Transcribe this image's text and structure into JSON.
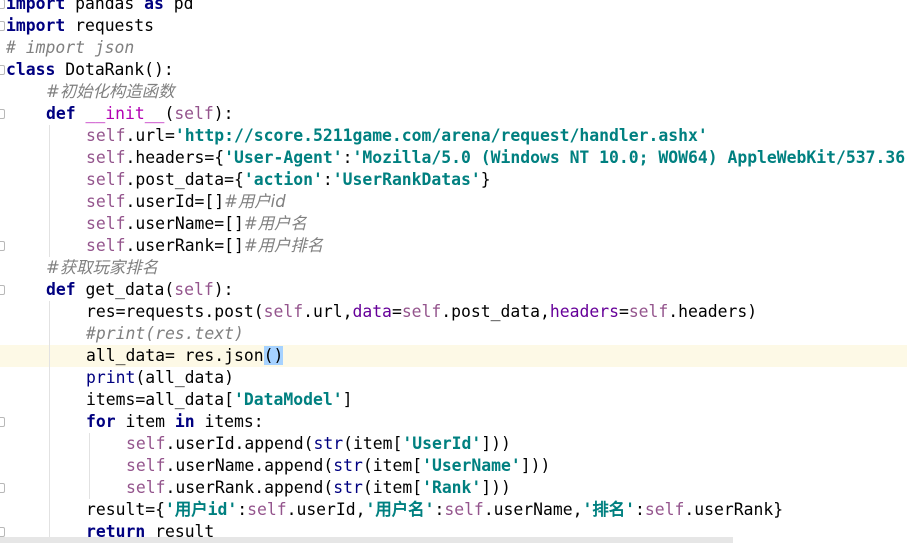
{
  "editor": {
    "language": "python",
    "current_line": 16,
    "lines": [
      {
        "indent": 0,
        "fold": true,
        "tokens": [
          [
            "kw",
            "import"
          ],
          [
            "plain",
            " pandas "
          ],
          [
            "kw",
            "as"
          ],
          [
            "plain",
            " pd"
          ]
        ]
      },
      {
        "indent": 0,
        "fold": true,
        "tokens": [
          [
            "kw",
            "import"
          ],
          [
            "plain",
            " requests"
          ]
        ]
      },
      {
        "indent": 0,
        "fold": false,
        "tokens": [
          [
            "cmt",
            "# import json"
          ]
        ]
      },
      {
        "indent": 0,
        "fold": true,
        "tokens": [
          [
            "kw",
            "class"
          ],
          [
            "plain",
            " DotaRank():"
          ]
        ]
      },
      {
        "indent": 1,
        "fold": false,
        "tokens": [
          [
            "cmt-cn",
            "#初始化构造函数"
          ]
        ]
      },
      {
        "indent": 1,
        "fold": true,
        "tokens": [
          [
            "kw",
            "def"
          ],
          [
            "plain",
            " "
          ],
          [
            "magic",
            "__init__"
          ],
          [
            "plain",
            "("
          ],
          [
            "self",
            "self"
          ],
          [
            "plain",
            "):"
          ]
        ]
      },
      {
        "indent": 2,
        "fold": false,
        "tokens": [
          [
            "self",
            "self"
          ],
          [
            "plain",
            ".url="
          ],
          [
            "str",
            "'http://score.5211game.com/arena/request/handler.ashx'"
          ]
        ]
      },
      {
        "indent": 2,
        "fold": false,
        "tokens": [
          [
            "self",
            "self"
          ],
          [
            "plain",
            ".headers={"
          ],
          [
            "str",
            "'User-Agent'"
          ],
          [
            "plain",
            ":"
          ],
          [
            "str",
            "'Mozilla/5.0 (Windows NT 10.0; WOW64) AppleWebKit/537.36"
          ]
        ]
      },
      {
        "indent": 2,
        "fold": false,
        "tokens": [
          [
            "self",
            "self"
          ],
          [
            "plain",
            ".post_data={"
          ],
          [
            "str",
            "'action'"
          ],
          [
            "plain",
            ":"
          ],
          [
            "str",
            "'UserRankDatas'"
          ],
          [
            "plain",
            "}"
          ]
        ]
      },
      {
        "indent": 2,
        "fold": false,
        "tokens": [
          [
            "self",
            "self"
          ],
          [
            "plain",
            ".userId=[]"
          ],
          [
            "cmt-cn",
            "#用户id"
          ]
        ]
      },
      {
        "indent": 2,
        "fold": false,
        "tokens": [
          [
            "self",
            "self"
          ],
          [
            "plain",
            ".userName=[]"
          ],
          [
            "cmt-cn",
            "#用户名"
          ]
        ]
      },
      {
        "indent": 2,
        "fold": true,
        "tokens": [
          [
            "self",
            "self"
          ],
          [
            "plain",
            ".userRank=[]"
          ],
          [
            "cmt-cn",
            "#用户排名"
          ]
        ]
      },
      {
        "indent": 1,
        "fold": false,
        "tokens": [
          [
            "cmt-cn",
            "#获取玩家排名"
          ]
        ]
      },
      {
        "indent": 1,
        "fold": true,
        "tokens": [
          [
            "kw",
            "def"
          ],
          [
            "plain",
            " get_data("
          ],
          [
            "self",
            "self"
          ],
          [
            "plain",
            "):"
          ]
        ]
      },
      {
        "indent": 2,
        "fold": false,
        "tokens": [
          [
            "plain",
            "res=requests.post("
          ],
          [
            "self",
            "self"
          ],
          [
            "plain",
            ".url,"
          ],
          [
            "param",
            "data"
          ],
          [
            "plain",
            "="
          ],
          [
            "self",
            "self"
          ],
          [
            "plain",
            ".post_data,"
          ],
          [
            "param",
            "headers"
          ],
          [
            "plain",
            "="
          ],
          [
            "self",
            "self"
          ],
          [
            "plain",
            ".headers)"
          ]
        ]
      },
      {
        "indent": 2,
        "fold": false,
        "tokens": [
          [
            "cmt",
            "#print(res.text)"
          ]
        ]
      },
      {
        "indent": 2,
        "fold": false,
        "tokens": [
          [
            "plain",
            "all_data= res.json"
          ],
          [
            "sel",
            "()"
          ]
        ]
      },
      {
        "indent": 2,
        "fold": false,
        "tokens": [
          [
            "builtin",
            "print"
          ],
          [
            "plain",
            "(all_data)"
          ]
        ]
      },
      {
        "indent": 2,
        "fold": false,
        "tokens": [
          [
            "plain",
            "items=all_data["
          ],
          [
            "str",
            "'DataModel'"
          ],
          [
            "plain",
            "]"
          ]
        ]
      },
      {
        "indent": 2,
        "fold": true,
        "tokens": [
          [
            "kw",
            "for"
          ],
          [
            "plain",
            " item "
          ],
          [
            "kw",
            "in"
          ],
          [
            "plain",
            " items:"
          ]
        ]
      },
      {
        "indent": 3,
        "fold": false,
        "tokens": [
          [
            "self",
            "self"
          ],
          [
            "plain",
            ".userId.append("
          ],
          [
            "builtin",
            "str"
          ],
          [
            "plain",
            "(item["
          ],
          [
            "str",
            "'UserId'"
          ],
          [
            "plain",
            "]))"
          ]
        ]
      },
      {
        "indent": 3,
        "fold": false,
        "tokens": [
          [
            "self",
            "self"
          ],
          [
            "plain",
            ".userName.append("
          ],
          [
            "builtin",
            "str"
          ],
          [
            "plain",
            "(item["
          ],
          [
            "str",
            "'UserName'"
          ],
          [
            "plain",
            "]))"
          ]
        ]
      },
      {
        "indent": 3,
        "fold": true,
        "tokens": [
          [
            "self",
            "self"
          ],
          [
            "plain",
            ".userRank.append("
          ],
          [
            "builtin",
            "str"
          ],
          [
            "plain",
            "(item["
          ],
          [
            "str",
            "'Rank'"
          ],
          [
            "plain",
            "]))"
          ]
        ]
      },
      {
        "indent": 2,
        "fold": false,
        "tokens": [
          [
            "plain",
            "result={"
          ],
          [
            "str",
            "'用户id'"
          ],
          [
            "plain",
            ":"
          ],
          [
            "self",
            "self"
          ],
          [
            "plain",
            ".userId,"
          ],
          [
            "str",
            "'用户名'"
          ],
          [
            "plain",
            ":"
          ],
          [
            "self",
            "self"
          ],
          [
            "plain",
            ".userName,"
          ],
          [
            "str",
            "'排名'"
          ],
          [
            "plain",
            ":"
          ],
          [
            "self",
            "self"
          ],
          [
            "plain",
            ".userRank}"
          ]
        ]
      },
      {
        "indent": 2,
        "fold": true,
        "tokens": [
          [
            "kw",
            "return"
          ],
          [
            "plain",
            " result"
          ]
        ]
      }
    ]
  }
}
